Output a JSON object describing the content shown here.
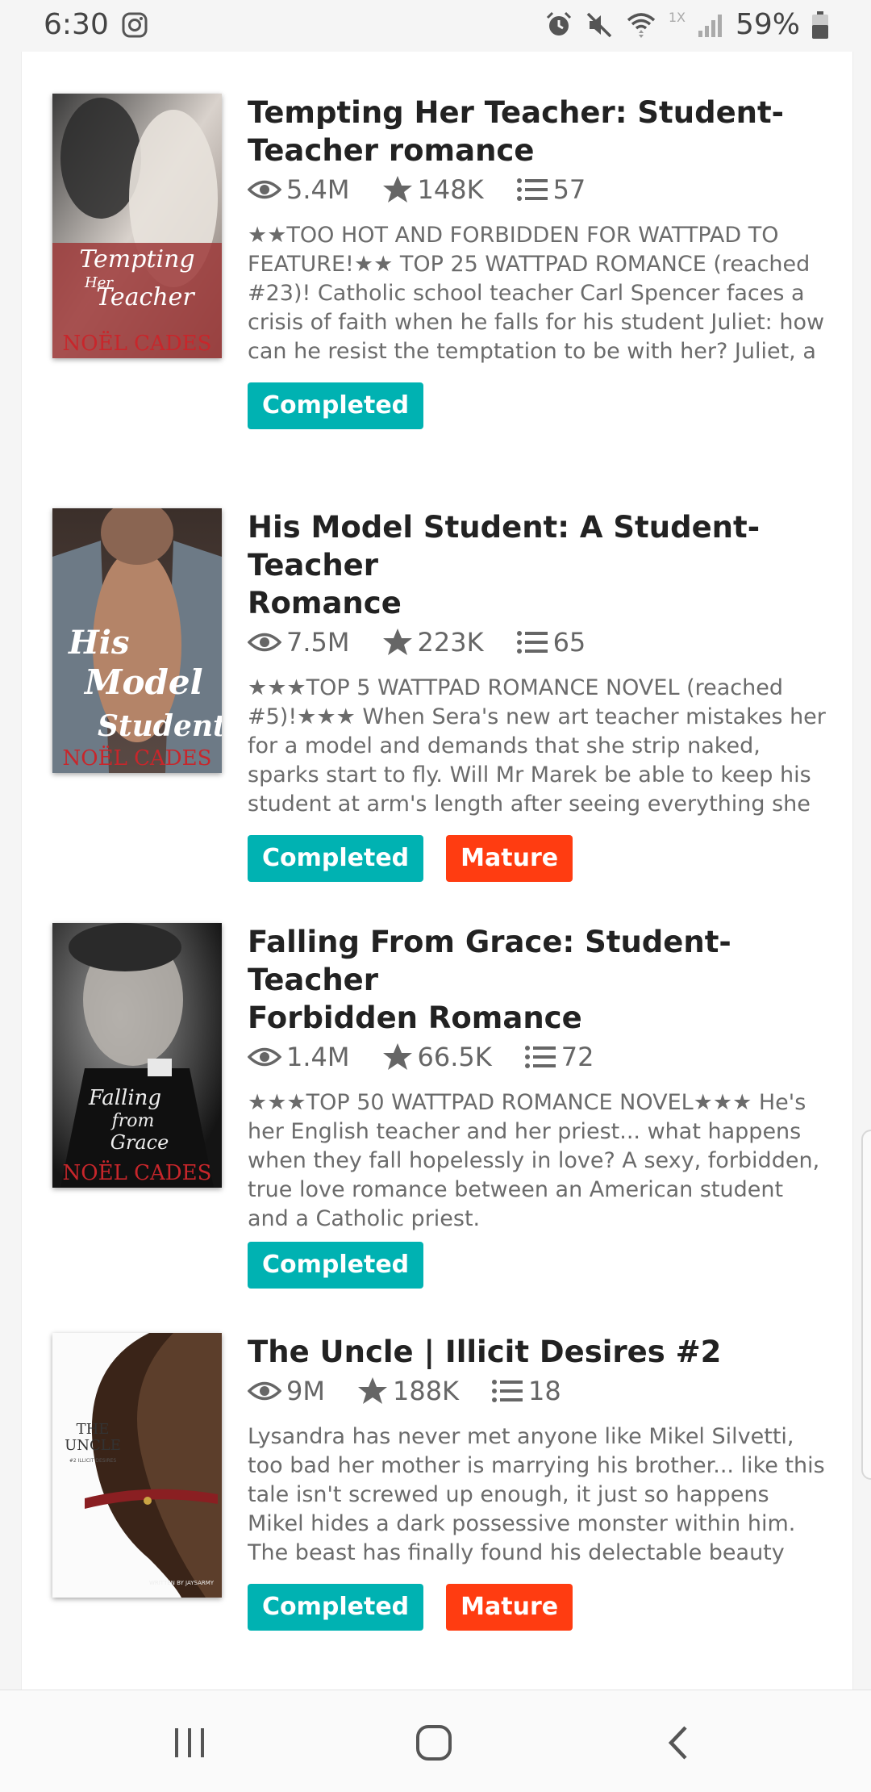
{
  "status_bar": {
    "time": "6:30",
    "battery": "59%",
    "network": "1X",
    "icons": [
      "instagram-icon",
      "alarm-icon",
      "mute-icon",
      "wifi-icon",
      "signal-icon",
      "battery-icon"
    ]
  },
  "stories": [
    {
      "title": "Tempting Her Teacher: Student-Teacher romance",
      "title_lines": [
        "Tempting Her Teacher: Student-",
        "Teacher romance"
      ],
      "reads": "5.4M",
      "votes": "148K",
      "parts": "57",
      "description": "★★TOO HOT AND FORBIDDEN FOR WATTPAD TO FEATURE!★★ TOP 25 WATTPAD ROMANCE (reached #23)! Catholic school teacher Carl Spencer faces a crisis of faith when he falls for his student Juliet: how can he resist the temptation to be with her? Juliet, a",
      "cover": {
        "lines": [
          "Tempting",
          "Her",
          "Teacher"
        ],
        "author": "NOËL CADES"
      },
      "tags": [
        "Completed"
      ]
    },
    {
      "title": "His Model Student: A Student-Teacher Romance",
      "title_lines": [
        "His Model Student: A Student-Teacher",
        "Romance"
      ],
      "reads": "7.5M",
      "votes": "223K",
      "parts": "65",
      "description": "★★★TOP 5 WATTPAD ROMANCE NOVEL (reached #5)!★★★ When Sera's new art teacher mistakes her for a model and demands that she strip naked, sparks start to fly. Will Mr Marek be able to keep his student at arm's length after seeing everything she",
      "cover": {
        "lines": [
          "His",
          "Model",
          "Student"
        ],
        "author": "NOËL CADES"
      },
      "tags": [
        "Completed",
        "Mature"
      ]
    },
    {
      "title": "Falling From Grace: Student-Teacher Forbidden Romance",
      "title_lines": [
        "Falling From Grace: Student-Teacher",
        "Forbidden Romance"
      ],
      "reads": "1.4M",
      "votes": "66.5K",
      "parts": "72",
      "description": "★★★TOP 50 WATTPAD ROMANCE NOVEL★★★ He's her English teacher and her priest... what happens when they fall hopelessly in love? A sexy, forbidden, true love romance between an American student and a Catholic priest.",
      "cover": {
        "lines": [
          "Falling",
          "from",
          "Grace"
        ],
        "author": "NOËL CADES"
      },
      "tags": [
        "Completed"
      ]
    },
    {
      "title": "The Uncle | Illicit Desires #2",
      "title_lines": [
        "The Uncle | Illicit Desires #2"
      ],
      "reads": "9M",
      "votes": "188K",
      "parts": "18",
      "description": "Lysandra has never met anyone like Mikel Silvetti, too bad her mother is marrying his brother... like this tale isn't screwed up enough, it just so happens Mikel hides a dark possessive monster within him. The beast has finally found his delectable beauty and",
      "cover": {
        "lines": [
          "THE",
          "UNCLE"
        ],
        "sub": "#2 ILLICIT DESIRES",
        "author": "WRITTEN BY JAYSARMY"
      },
      "tags": [
        "Completed",
        "Mature"
      ]
    }
  ],
  "colors": {
    "completed": "#00b2b2",
    "mature": "#ff3c11",
    "author_red": "#c8262b"
  },
  "nav_bar": [
    "recent-apps-icon",
    "home-icon",
    "back-icon"
  ]
}
